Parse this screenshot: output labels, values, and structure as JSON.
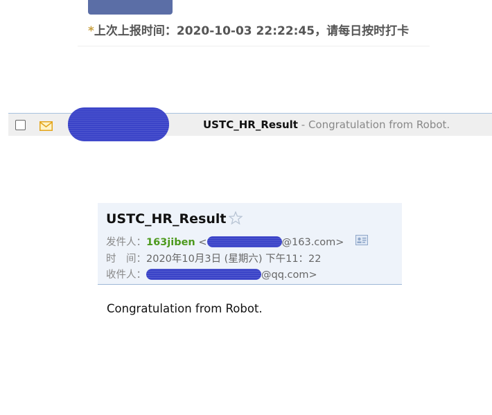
{
  "notice": {
    "star": "*",
    "text": "上次上报时间：2020-10-03 22:22:45，请每日按时打卡"
  },
  "list_row": {
    "subject": "USTC_HR_Result",
    "separator": " - ",
    "preview": "Congratulation from Robot."
  },
  "mail": {
    "title": "USTC_HR_Result",
    "from_label": "发件人：",
    "from_name": "163jiben",
    "from_open": " <",
    "from_domain": "@163.com>",
    "time_label": "时　间：",
    "time_value": "2020年10月3日 (星期六) 下午11：22",
    "to_label": "收件人：",
    "to_domain": "@qq.com>",
    "body": "Congratulation from Robot."
  },
  "icons": {
    "row_status": "envelope-icon",
    "favorite": "star-outline-icon",
    "contact": "contact-card-icon"
  },
  "colors": {
    "redaction": "#3a43c8",
    "sender_name": "#4e9a1e",
    "notice_star": "#c8a040",
    "header_bar": "#5b6ea6"
  }
}
